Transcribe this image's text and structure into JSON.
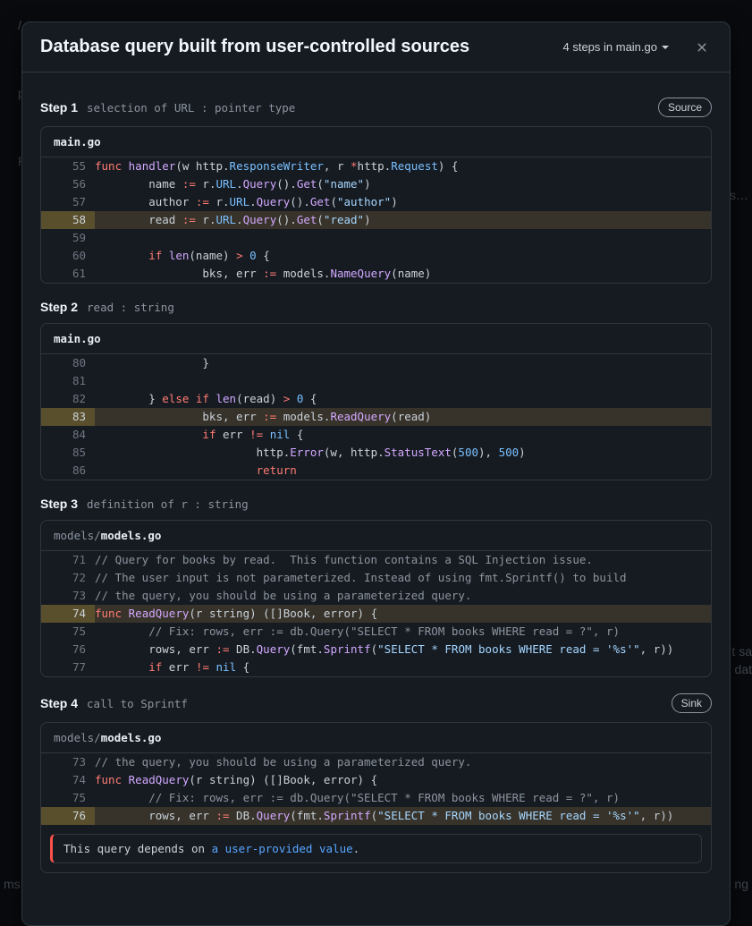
{
  "dim": {
    "crumb": "/ a…",
    "line2": "p/ad…",
    "p": "P…",
    "u": "us…",
    "sa": "t sa",
    "dat": "dat",
    "ms": "ms",
    "ng": "ng"
  },
  "header": {
    "title": "Database query built from user-controlled sources",
    "steps_label": "4 steps in main.go"
  },
  "steps": [
    {
      "id": "Step 1",
      "desc": "selection of URL : pointer type",
      "badge": "Source",
      "file_dir": "",
      "file_name": "main.go",
      "lines": [
        {
          "n": 55,
          "hl": false,
          "tokens": [
            [
              "kw",
              "func"
            ],
            [
              "sp",
              " "
            ],
            [
              "fn",
              "handler"
            ],
            [
              "id",
              "(w http"
            ],
            [
              "id",
              "."
            ],
            [
              "prop",
              "ResponseWriter"
            ],
            [
              "id",
              ", r "
            ],
            [
              "op",
              "*"
            ],
            [
              "id",
              "http"
            ],
            [
              "id",
              "."
            ],
            [
              "prop",
              "Request"
            ],
            [
              "id",
              ") {"
            ]
          ]
        },
        {
          "n": 56,
          "hl": false,
          "tokens": [
            [
              "id",
              "        name "
            ],
            [
              "op",
              ":="
            ],
            [
              "id",
              " r."
            ],
            [
              "prop",
              "URL"
            ],
            [
              "id",
              "."
            ],
            [
              "fn",
              "Query"
            ],
            [
              "id",
              "()."
            ],
            [
              "fn",
              "Get"
            ],
            [
              "id",
              "("
            ],
            [
              "str",
              "\"name\""
            ],
            [
              "id",
              ")"
            ]
          ]
        },
        {
          "n": 57,
          "hl": false,
          "tokens": [
            [
              "id",
              "        author "
            ],
            [
              "op",
              ":="
            ],
            [
              "id",
              " r."
            ],
            [
              "prop",
              "URL"
            ],
            [
              "id",
              "."
            ],
            [
              "fn",
              "Query"
            ],
            [
              "id",
              "()."
            ],
            [
              "fn",
              "Get"
            ],
            [
              "id",
              "("
            ],
            [
              "str",
              "\"author\""
            ],
            [
              "id",
              ")"
            ]
          ]
        },
        {
          "n": 58,
          "hl": true,
          "tokens": [
            [
              "id",
              "        read "
            ],
            [
              "op",
              ":="
            ],
            [
              "id",
              " r."
            ],
            [
              "prop",
              "URL"
            ],
            [
              "id",
              "."
            ],
            [
              "fn",
              "Query"
            ],
            [
              "id",
              "()."
            ],
            [
              "fn",
              "Get"
            ],
            [
              "id",
              "("
            ],
            [
              "str",
              "\"read\""
            ],
            [
              "id",
              ")"
            ]
          ]
        },
        {
          "n": 59,
          "hl": false,
          "tokens": [
            [
              "id",
              ""
            ]
          ]
        },
        {
          "n": 60,
          "hl": false,
          "tokens": [
            [
              "id",
              "        "
            ],
            [
              "kw",
              "if"
            ],
            [
              "id",
              " "
            ],
            [
              "fn",
              "len"
            ],
            [
              "id",
              "(name) "
            ],
            [
              "op",
              ">"
            ],
            [
              "id",
              " "
            ],
            [
              "num",
              "0"
            ],
            [
              "id",
              " {"
            ]
          ]
        },
        {
          "n": 61,
          "hl": false,
          "tokens": [
            [
              "id",
              "                bks, err "
            ],
            [
              "op",
              ":="
            ],
            [
              "id",
              " models."
            ],
            [
              "fn",
              "NameQuery"
            ],
            [
              "id",
              "(name)"
            ]
          ]
        }
      ]
    },
    {
      "id": "Step 2",
      "desc": "read : string",
      "badge": null,
      "file_dir": "",
      "file_name": "main.go",
      "lines": [
        {
          "n": 80,
          "hl": false,
          "tokens": [
            [
              "id",
              "                }"
            ]
          ]
        },
        {
          "n": 81,
          "hl": false,
          "tokens": [
            [
              "id",
              ""
            ]
          ]
        },
        {
          "n": 82,
          "hl": false,
          "tokens": [
            [
              "id",
              "        } "
            ],
            [
              "kw",
              "else"
            ],
            [
              "id",
              " "
            ],
            [
              "kw",
              "if"
            ],
            [
              "id",
              " "
            ],
            [
              "fn",
              "len"
            ],
            [
              "id",
              "(read) "
            ],
            [
              "op",
              ">"
            ],
            [
              "id",
              " "
            ],
            [
              "num",
              "0"
            ],
            [
              "id",
              " {"
            ]
          ]
        },
        {
          "n": 83,
          "hl": true,
          "tokens": [
            [
              "id",
              "                bks, err "
            ],
            [
              "op",
              ":="
            ],
            [
              "id",
              " models."
            ],
            [
              "fn",
              "ReadQuery"
            ],
            [
              "id",
              "(read)"
            ]
          ]
        },
        {
          "n": 84,
          "hl": false,
          "tokens": [
            [
              "id",
              "                "
            ],
            [
              "kw",
              "if"
            ],
            [
              "id",
              " err "
            ],
            [
              "op",
              "!="
            ],
            [
              "id",
              " "
            ],
            [
              "nil",
              "nil"
            ],
            [
              "id",
              " {"
            ]
          ]
        },
        {
          "n": 85,
          "hl": false,
          "tokens": [
            [
              "id",
              "                        http."
            ],
            [
              "fn",
              "Error"
            ],
            [
              "id",
              "(w, http."
            ],
            [
              "fn",
              "StatusText"
            ],
            [
              "id",
              "("
            ],
            [
              "num",
              "500"
            ],
            [
              "id",
              "), "
            ],
            [
              "num",
              "500"
            ],
            [
              "id",
              ")"
            ]
          ]
        },
        {
          "n": 86,
          "hl": false,
          "tokens": [
            [
              "id",
              "                        "
            ],
            [
              "kw",
              "return"
            ]
          ]
        }
      ]
    },
    {
      "id": "Step 3",
      "desc": "definition of r : string",
      "badge": null,
      "file_dir": "models/",
      "file_name": "models.go",
      "lines": [
        {
          "n": 71,
          "hl": false,
          "tokens": [
            [
              "cm",
              "// Query for books by read.  This function contains a SQL Injection issue."
            ]
          ]
        },
        {
          "n": 72,
          "hl": false,
          "tokens": [
            [
              "cm",
              "// The user input is not parameterized. Instead of using fmt.Sprintf() to build"
            ]
          ]
        },
        {
          "n": 73,
          "hl": false,
          "tokens": [
            [
              "cm",
              "// the query, you should be using a parameterized query."
            ]
          ]
        },
        {
          "n": 74,
          "hl": true,
          "tokens": [
            [
              "kw",
              "func"
            ],
            [
              "id",
              " "
            ],
            [
              "fn",
              "ReadQuery"
            ],
            [
              "id",
              "(r "
            ],
            [
              "id",
              "string"
            ],
            [
              "id",
              ") ([]Book, "
            ],
            [
              "id",
              "error"
            ],
            [
              "id",
              ") {"
            ]
          ]
        },
        {
          "n": 75,
          "hl": false,
          "tokens": [
            [
              "id",
              "        "
            ],
            [
              "cm",
              "// Fix: rows, err := db.Query(\"SELECT * FROM books WHERE read = ?\", r)"
            ]
          ]
        },
        {
          "n": 76,
          "hl": false,
          "tokens": [
            [
              "id",
              "        rows, err "
            ],
            [
              "op",
              ":="
            ],
            [
              "id",
              " DB."
            ],
            [
              "fn",
              "Query"
            ],
            [
              "id",
              "(fmt."
            ],
            [
              "fn",
              "Sprintf"
            ],
            [
              "id",
              "("
            ],
            [
              "str",
              "\"SELECT * FROM books WHERE read = '%s'\""
            ],
            [
              "id",
              ", r))"
            ]
          ]
        },
        {
          "n": 77,
          "hl": false,
          "tokens": [
            [
              "id",
              "        "
            ],
            [
              "kw",
              "if"
            ],
            [
              "id",
              " err "
            ],
            [
              "op",
              "!="
            ],
            [
              "id",
              " "
            ],
            [
              "nil",
              "nil"
            ],
            [
              "id",
              " {"
            ]
          ]
        }
      ]
    },
    {
      "id": "Step 4",
      "desc": "call to Sprintf",
      "badge": "Sink",
      "file_dir": "models/",
      "file_name": "models.go",
      "lines": [
        {
          "n": 73,
          "hl": false,
          "tokens": [
            [
              "cm",
              "// the query, you should be using a parameterized query."
            ]
          ]
        },
        {
          "n": 74,
          "hl": false,
          "tokens": [
            [
              "kw",
              "func"
            ],
            [
              "id",
              " "
            ],
            [
              "fn",
              "ReadQuery"
            ],
            [
              "id",
              "(r "
            ],
            [
              "id",
              "string"
            ],
            [
              "id",
              ") ([]Book, "
            ],
            [
              "id",
              "error"
            ],
            [
              "id",
              ") {"
            ]
          ]
        },
        {
          "n": 75,
          "hl": false,
          "tokens": [
            [
              "id",
              "        "
            ],
            [
              "cm",
              "// Fix: rows, err := db.Query(\"SELECT * FROM books WHERE read = ?\", r)"
            ]
          ]
        },
        {
          "n": 76,
          "hl": true,
          "tokens": [
            [
              "id",
              "        rows, err "
            ],
            [
              "op",
              ":="
            ],
            [
              "id",
              " DB."
            ],
            [
              "fn",
              "Query"
            ],
            [
              "id",
              "(fmt."
            ],
            [
              "fn",
              "Sprintf"
            ],
            [
              "id",
              "("
            ],
            [
              "str",
              "\"SELECT * FROM books WHERE read = '%s'\""
            ],
            [
              "id",
              ", r))"
            ]
          ]
        }
      ],
      "alert_prefix": "This query depends on ",
      "alert_link": "a user-provided value",
      "alert_suffix": "."
    }
  ]
}
